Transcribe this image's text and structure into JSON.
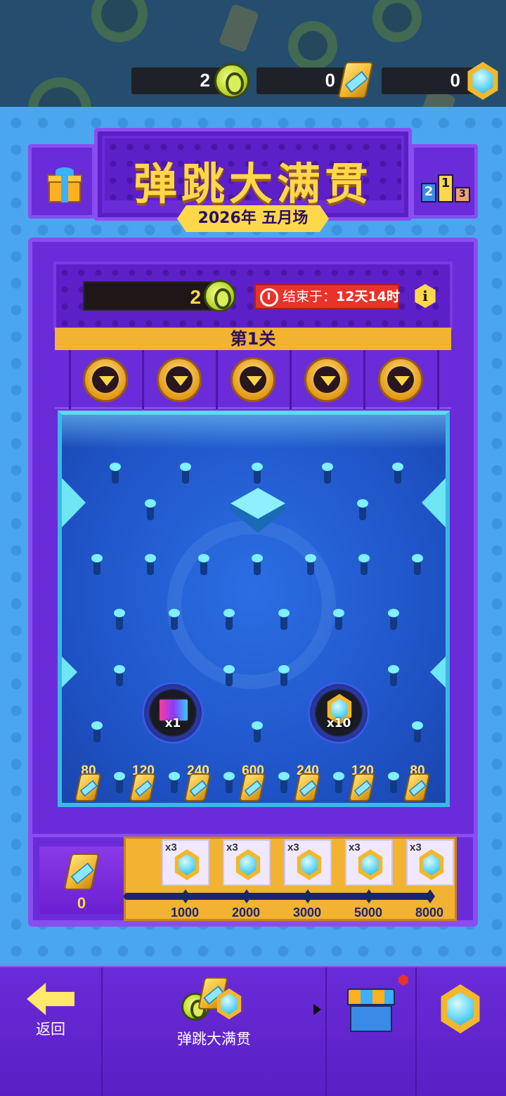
{
  "currencies": {
    "coins": "2",
    "tickets": "0",
    "gems": "0"
  },
  "event": {
    "title": "弹跳大满贯",
    "season": "2026年 五月场"
  },
  "machine": {
    "score": "2",
    "timer_prefix": "结束于：",
    "timer_value": "12天14时",
    "info_label": "i",
    "level": "第1关"
  },
  "board": {
    "prizes": [
      {
        "label": "x1",
        "icon": "card-icon"
      },
      {
        "label": "x10",
        "icon": "gem-icon"
      }
    ],
    "slots": [
      "80",
      "120",
      "240",
      "600",
      "240",
      "120",
      "80"
    ]
  },
  "progress": {
    "tickets": "0",
    "rewards": [
      {
        "qty": "x3",
        "milestone": "1000",
        "icon": "gem-icon"
      },
      {
        "qty": "x3",
        "milestone": "2000",
        "icon": "gem-icon"
      },
      {
        "qty": "x3",
        "milestone": "3000",
        "icon": "gem-icon"
      },
      {
        "qty": "x3",
        "milestone": "5000",
        "icon": "gem-icon"
      },
      {
        "qty": "x3",
        "milestone": "8000",
        "icon": "gem-icon"
      }
    ]
  },
  "nav": {
    "back": "返回",
    "current": "弹跳大满贯"
  },
  "podium": [
    "2",
    "1",
    "3"
  ]
}
